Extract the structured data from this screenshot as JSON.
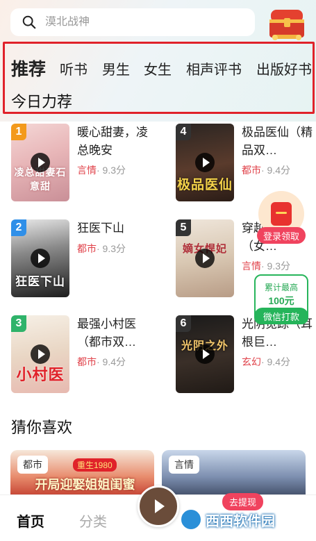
{
  "search": {
    "placeholder": "漠北战神"
  },
  "tabs": [
    {
      "label": "推荐",
      "active": true
    },
    {
      "label": "听书",
      "active": false
    },
    {
      "label": "男生",
      "active": false
    },
    {
      "label": "女生",
      "active": false
    },
    {
      "label": "相声评书",
      "active": false
    },
    {
      "label": "出版好书",
      "active": false
    }
  ],
  "sections": {
    "today": "今日力荐",
    "guess": "猜你喜欢"
  },
  "books": [
    {
      "rank": "1",
      "title": "暖心甜妻，凌总晚安",
      "genre": "言情",
      "score": "· 9.3分",
      "cover_text": "凌总甜妻石意甜"
    },
    {
      "rank": "2",
      "title": "狂医下山",
      "genre": "都市",
      "score": "· 9.3分",
      "cover_text": "狂医下山"
    },
    {
      "rank": "3",
      "title": "最强小村医（都市双…",
      "genre": "都市",
      "score": "· 9.4分",
      "cover_text": "小村医"
    },
    {
      "rank": "4",
      "title": "极品医仙（精品双…",
      "genre": "都市",
      "score": "· 9.4分",
      "cover_text": "极品医仙"
    },
    {
      "rank": "5",
      "title": "穿越悍妃（女…",
      "genre": "言情",
      "score": "· 9.3分",
      "cover_text": "嫡女悍妃"
    },
    {
      "rank": "6",
      "title": "光阴觅踪（耳根巨…",
      "genre": "玄幻",
      "score": "· 9.4分",
      "cover_text": "光阴之外"
    }
  ],
  "floating": {
    "gift_label": "登录领取",
    "cash_line1": "累计最高",
    "cash_line2": "100元",
    "cash_button": "微信打款",
    "withdraw": "去提现"
  },
  "recommend_cards": [
    {
      "tag": "都市",
      "cover_text": "开局迎娶姐姐闺蜜",
      "badge": "重生1980"
    },
    {
      "tag": "言情"
    }
  ],
  "bottom_nav": {
    "home": "首页",
    "category": "分类"
  },
  "watermark": "西西软件园",
  "colors": {
    "accent_red": "#e0222a",
    "genre_red": "#e0424a",
    "green": "#27b55b",
    "rank_orange": "#f39a1c",
    "rank_blue": "#2f8fe8",
    "rank_green": "#2fb36a",
    "rank_dark": "#333333"
  },
  "icons": [
    "search-icon",
    "treasure-chest-icon",
    "play-icon",
    "red-envelope-icon"
  ]
}
